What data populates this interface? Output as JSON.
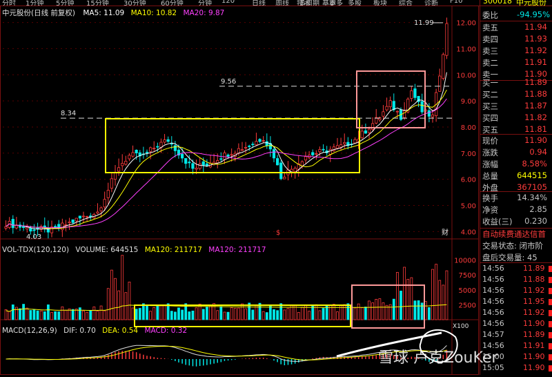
{
  "topbar": {
    "periods": [
      "分时",
      "1分钟",
      "5分钟",
      "15分钟",
      "30分钟",
      "60分钟",
      "分钟",
      "120",
      "日线",
      "周线",
      "多周期",
      "更多"
    ],
    "right_tabs": [
      "技术",
      "基本",
      "多股",
      "板块",
      "综合",
      "诊断",
      "F10"
    ],
    "stock_code": "300018",
    "stock_name": "中元股份"
  },
  "kline": {
    "title": "中元股份(日线 前复权)",
    "ma5": "MA5: 11.09",
    "ma10": "MA10: 10.82",
    "ma20": "MA20: 9.87",
    "high_label": "11.99",
    "low_label": "4.03",
    "line1_label": "9.56",
    "line2_label": "8.34",
    "marker_s": "$",
    "marker_cai": "财",
    "axis": [
      "12.00",
      "11.00",
      "10.00",
      "9.00",
      "8.00",
      "7.00",
      "6.00",
      "5.00",
      "4.00"
    ]
  },
  "volume": {
    "title": "VOL-TDX(120,120)",
    "volume": "VOLUME: 644515",
    "ma120a": "MA120: 211717",
    "ma120b": "MA120: 211717",
    "axis": [
      "10000",
      "7500",
      "5000",
      "2500"
    ],
    "unit": "X100"
  },
  "macd": {
    "title": "MACD(12,26,9)",
    "dif": "DIF: 0.70",
    "dea": "DEA: 0.54",
    "macd": "MACD: 0.32"
  },
  "watermark": "雪球  卢克ZouKer",
  "quote": {
    "weibi_label": "委比",
    "weibi_value": "-94.95%",
    "weibi_extra": "",
    "asks": [
      {
        "label": "卖五",
        "price": "11.94"
      },
      {
        "label": "卖四",
        "price": "11.93"
      },
      {
        "label": "卖三",
        "price": "11.92"
      },
      {
        "label": "卖二",
        "price": "11.91"
      },
      {
        "label": "卖一",
        "price": "11.90"
      }
    ],
    "bids": [
      {
        "label": "买一",
        "price": "11.89"
      },
      {
        "label": "买二",
        "price": "11.88"
      },
      {
        "label": "买三",
        "price": "11.87"
      },
      {
        "label": "买四",
        "price": "11.82"
      },
      {
        "label": "买五",
        "price": "11.81"
      }
    ],
    "stats": [
      {
        "label": "现价",
        "value": "11.90",
        "cls": "red"
      },
      {
        "label": "涨跌",
        "value": "0.94",
        "cls": "red"
      },
      {
        "label": "涨幅",
        "value": "8.58%",
        "cls": "red"
      },
      {
        "label": "总量",
        "value": "644515",
        "cls": "yellow"
      },
      {
        "label": "外盘",
        "value": "367105",
        "cls": "red"
      }
    ],
    "stats2": [
      {
        "label": "换手",
        "value": "14.34%"
      },
      {
        "label": "净资",
        "value": "2.85"
      },
      {
        "label": "收益(三)",
        "value": "0.230"
      }
    ],
    "notice": "自动续费通达信首",
    "trade_status": "交易状态: 闭市阶",
    "after_hours": "盘后交易量: 45",
    "ticks": [
      {
        "time": "14:56",
        "price": "11.89"
      },
      {
        "time": "14:56",
        "price": "11.88"
      },
      {
        "time": "14:56",
        "price": "11.92"
      },
      {
        "time": "14:56",
        "price": "11.95"
      },
      {
        "time": "14:56",
        "price": "11.92"
      },
      {
        "time": "14:56",
        "price": "11.90"
      },
      {
        "time": "14:57",
        "price": "11.89"
      },
      {
        "time": "14:56",
        "price": "11.91"
      },
      {
        "time": "15:00",
        "price": "11.90"
      },
      {
        "time": "15:05",
        "price": "11.90"
      }
    ]
  },
  "colors": {
    "up": "#ff3c3c",
    "down": "#00e8e8",
    "ma5": "#ffffff",
    "ma10": "#ffff00",
    "ma20": "#ff40ff",
    "yellow_box": "#ffff00",
    "pink_box": "#ff9a9a",
    "frame": "#7a1010"
  }
}
